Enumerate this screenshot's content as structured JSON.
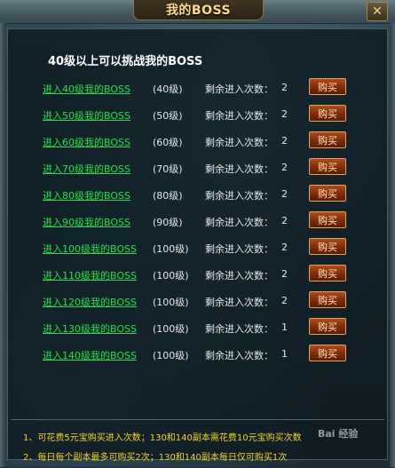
{
  "window": {
    "title": "我的BOSS",
    "close_label": "✕"
  },
  "header": "40级以上可以挑战我的BOSS",
  "rows": [
    {
      "link": "进入40级我的BOSS",
      "level": "(40级)",
      "remain_label": "剩余进入次数：",
      "remain_count": "2",
      "buy_label": "购买"
    },
    {
      "link": "进入50级我的BOSS",
      "level": "(50级)",
      "remain_label": "剩余进入次数：",
      "remain_count": "2",
      "buy_label": "购买"
    },
    {
      "link": "进入60级我的BOSS",
      "level": "(60级)",
      "remain_label": "剩余进入次数：",
      "remain_count": "2",
      "buy_label": "购买"
    },
    {
      "link": "进入70级我的BOSS",
      "level": "(70级)",
      "remain_label": "剩余进入次数：",
      "remain_count": "2",
      "buy_label": "购买"
    },
    {
      "link": "进入80级我的BOSS",
      "level": "(80级)",
      "remain_label": "剩余进入次数：",
      "remain_count": "2",
      "buy_label": "购买"
    },
    {
      "link": "进入90级我的BOSS",
      "level": "(90级)",
      "remain_label": "剩余进入次数：",
      "remain_count": "2",
      "buy_label": "购买"
    },
    {
      "link": "进入100级我的BOSS",
      "level": "(100级)",
      "remain_label": "剩余进入次数：",
      "remain_count": "2",
      "buy_label": "购买"
    },
    {
      "link": "进入110级我的BOSS",
      "level": "(100级)",
      "remain_label": "剩余进入次数：",
      "remain_count": "2",
      "buy_label": "购买"
    },
    {
      "link": "进入120级我的BOSS",
      "level": "(100级)",
      "remain_label": "剩余进入次数：",
      "remain_count": "2",
      "buy_label": "购买"
    },
    {
      "link": "进入130级我的BOSS",
      "level": "(100级)",
      "remain_label": "剩余进入次数：",
      "remain_count": "1",
      "buy_label": "购买"
    },
    {
      "link": "进入140级我的BOSS",
      "level": "(100级)",
      "remain_label": "剩余进入次数：",
      "remain_count": "1",
      "buy_label": "购买"
    }
  ],
  "notes": [
    "1、可花费5元宝购买进入次数；130和140副本需花费10元宝购买次数",
    "2、每日每个副本最多可购买2次；130和140副本每日仅可购买1次"
  ],
  "watermark": "Bai 经验",
  "colors": {
    "link": "#22e04a",
    "notes": "#f2d21e",
    "title": "#ffd98a",
    "buy_button": "#7e2b0c"
  },
  "icons": {
    "close": "close-icon"
  }
}
